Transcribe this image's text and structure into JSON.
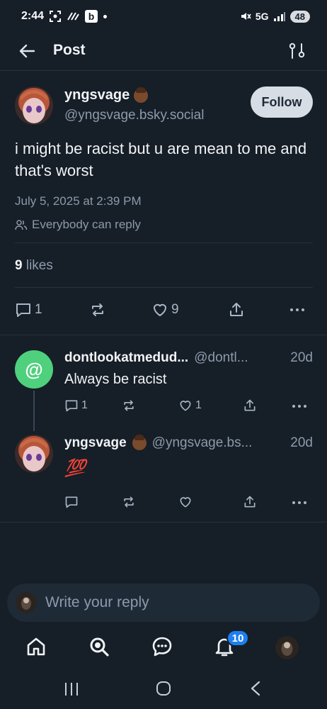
{
  "status_bar": {
    "time": "2:44",
    "network": "5G",
    "battery": "48"
  },
  "header": {
    "title": "Post"
  },
  "post": {
    "author_name": "yngsvage",
    "author_handle": "@yngsvage.bsky.social",
    "follow_label": "Follow",
    "text": "i might be racist but u are mean to me and that's worst",
    "date": "July 5, 2025 at 2:39 PM",
    "reply_permission": "Everybody can reply",
    "likes_count": "9",
    "likes_label": "likes",
    "reply_count": "1",
    "like_count": "9"
  },
  "replies": [
    {
      "name": "dontlookatmedud...",
      "handle": "@dontl...",
      "time": "20d",
      "text": "Always be racist",
      "reply_count": "1",
      "like_count": "1",
      "avatar_symbol": "@"
    },
    {
      "name": "yngsvage",
      "handle": "@yngsvage.bs...",
      "time": "20d",
      "text": "💯",
      "reply_count": "",
      "like_count": ""
    }
  ],
  "reply_input": {
    "placeholder": "Write your reply"
  },
  "bottom_nav": {
    "notifications_badge": "10"
  },
  "colors": {
    "background": "#161e27",
    "accent": "#1d7ff0",
    "avatar_green": "#4fd07d",
    "hundred_red": "#e8294c"
  },
  "icons": [
    "back-arrow-icon",
    "filter-icon",
    "people-icon",
    "reply-icon",
    "repost-icon",
    "heart-icon",
    "share-icon",
    "more-icon",
    "home-icon",
    "search-icon",
    "chat-icon",
    "bell-icon"
  ]
}
